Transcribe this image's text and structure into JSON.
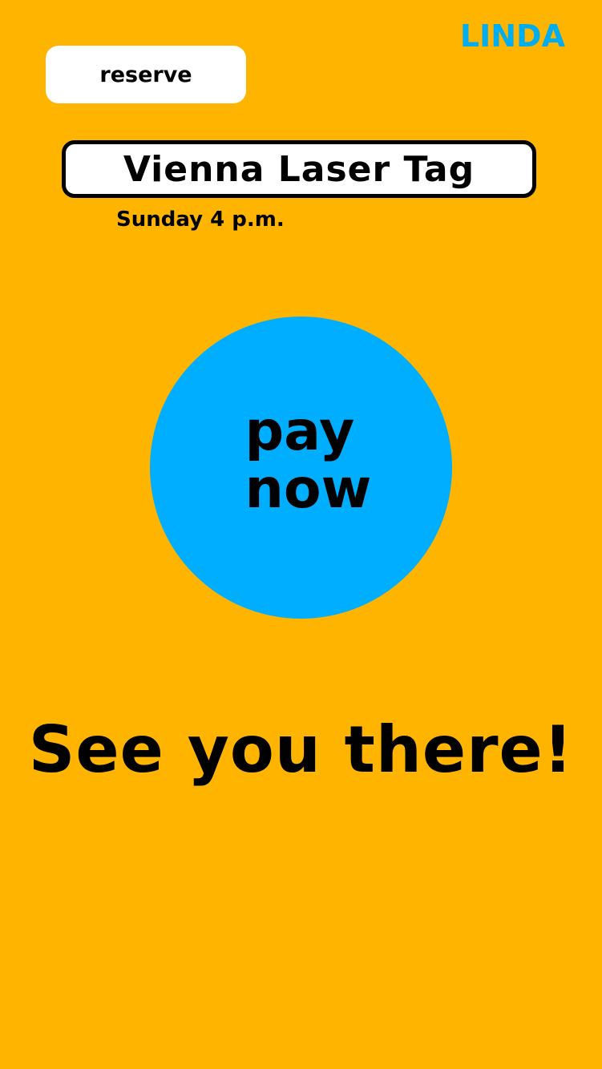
{
  "header": {
    "brand": "LINDA",
    "reserve_label": "reserve"
  },
  "event": {
    "title": "Vienna Laser Tag",
    "time": "Sunday 4 p.m."
  },
  "payment": {
    "button_label": "pay\nnow"
  },
  "footer": {
    "message": "See you there!"
  },
  "colors": {
    "background": "#FFB500",
    "accent": "#00AEFF",
    "brand": "#00AEEF",
    "card": "#FFFFFF",
    "text": "#000000"
  }
}
